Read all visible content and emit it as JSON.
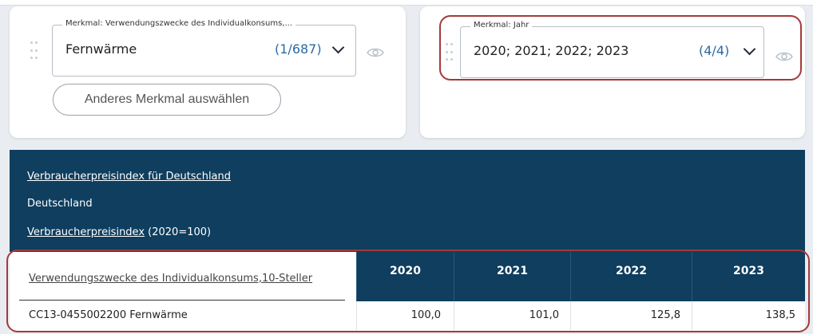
{
  "filters": [
    {
      "legend": "Merkmal: Verwendungszwecke des Individualkonsums,...",
      "value": "Fernwärme",
      "count": "(1/687)",
      "other_button": "Anderes Merkmal auswählen"
    },
    {
      "legend": "Merkmal: Jahr",
      "value": "2020; 2021; 2022; 2023",
      "count": "(4/4)"
    }
  ],
  "info": {
    "title": "Verbraucherpreisindex für Deutschland",
    "region": "Deutschland",
    "measure_link": "Verbraucherpreisindex",
    "measure_suffix": " (2020=100)"
  },
  "table": {
    "row_header": "Verwendungszwecke des Individualkonsums,10-Steller",
    "years": [
      "2020",
      "2021",
      "2022",
      "2023"
    ],
    "rows": [
      {
        "label": "CC13-0455002200 Fernwärme",
        "values": [
          "100,0",
          "101,0",
          "125,8",
          "138,5"
        ]
      }
    ]
  },
  "colors": {
    "navy": "#0f3e5e",
    "highlight": "#a33a3a",
    "accent": "#2a6aa3"
  },
  "icons": [
    "drag-handle-icon",
    "chevron-down-icon",
    "eye-icon"
  ]
}
